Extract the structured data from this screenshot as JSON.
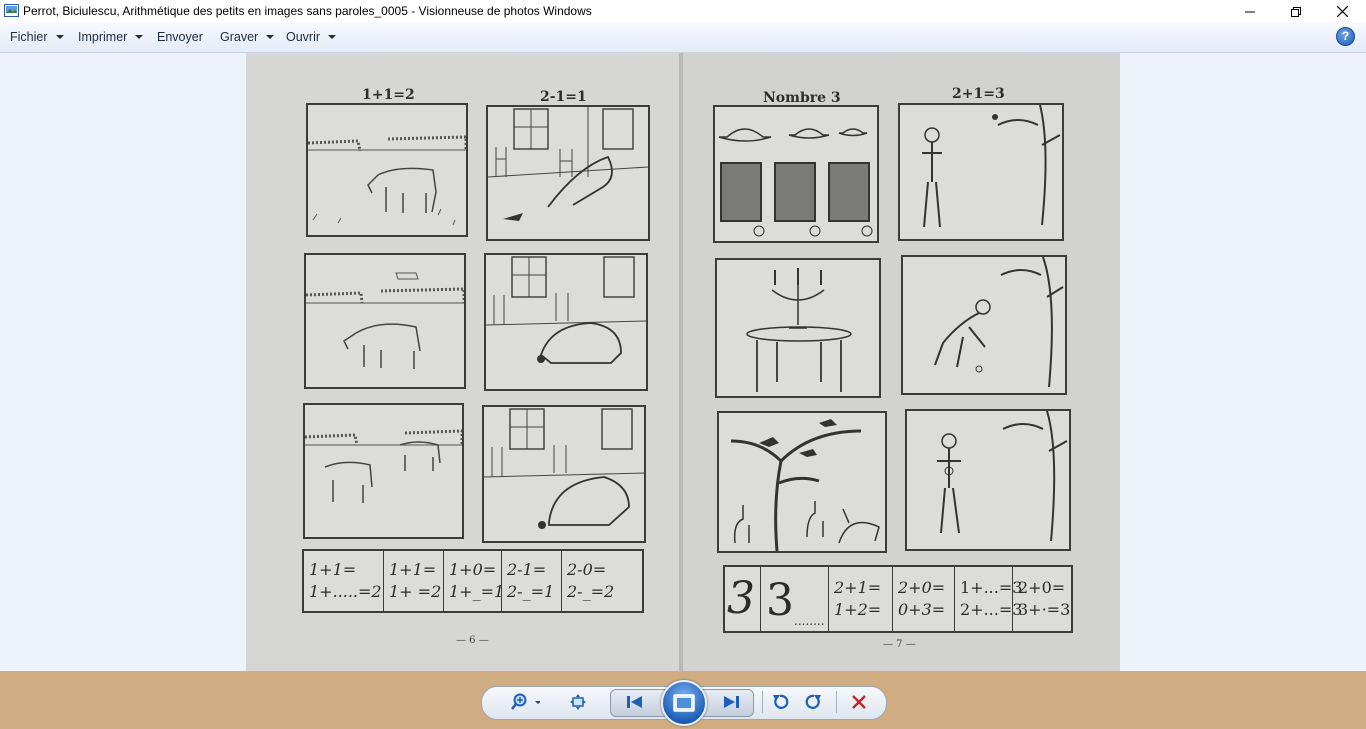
{
  "window": {
    "title": "Perrot, Biciulescu, Arithmétique des petits en images sans paroles_0005 - Visionneuse de photos Windows"
  },
  "menu": {
    "items": [
      {
        "label": "Fichier"
      },
      {
        "label": "Imprimer"
      },
      {
        "label": "Envoyer"
      },
      {
        "label": "Graver"
      },
      {
        "label": "Ouvrir"
      }
    ],
    "help_label": "?"
  },
  "photo": {
    "left_page": {
      "heading_1": "1+1=2",
      "heading_2": "2-1=1",
      "math": [
        [
          "1+1=",
          "1+.....=2"
        ],
        [
          "1+1=",
          "1+ =2"
        ],
        [
          "1+0=",
          "1+_=1"
        ],
        [
          "2-1=",
          "2-_=1"
        ],
        [
          "2-0=",
          "2-_=2"
        ]
      ],
      "page_number": "— 6 —"
    },
    "right_page": {
      "heading_1": "Nombre 3",
      "heading_2": "2+1=3",
      "big_digit_1": "3",
      "big_digit_2": "3",
      "big_digit_dots": "........",
      "math": [
        [
          "2+1=",
          "1+2="
        ],
        [
          "2+0=",
          "0+3="
        ],
        [
          "1+...=3",
          "2+...=3"
        ],
        [
          "2+0=",
          "3+·=3"
        ]
      ],
      "page_number": "— 7 —"
    }
  },
  "toolbar": {
    "icons": [
      "zoom-icon",
      "fit-window-icon",
      "previous-icon",
      "slideshow-icon",
      "next-icon",
      "rotate-left-icon",
      "rotate-right-icon",
      "delete-icon"
    ]
  },
  "colors": {
    "background": "#eef3fa",
    "bottom_bar": "#d0ac82",
    "accent": "#1d5fb8",
    "delete": "#c0262d"
  }
}
